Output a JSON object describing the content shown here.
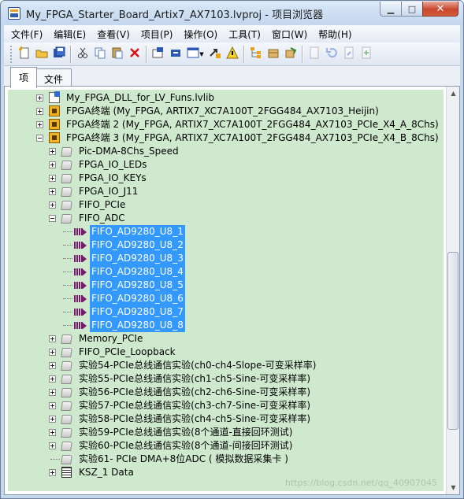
{
  "window": {
    "title": "My_FPGA_Starter_Board_Artix7_AX7103.lvproj - 项目浏览器",
    "caption": {
      "minimize": "▁",
      "maximize": "□",
      "close": "✕"
    }
  },
  "menu": [
    "文件(F)",
    "编辑(E)",
    "查看(V)",
    "项目(P)",
    "操作(O)",
    "工具(T)",
    "窗口(W)",
    "帮助(H)"
  ],
  "toolbar": {
    "buttons": [
      {
        "icon": "new-icon"
      },
      {
        "icon": "open-icon"
      },
      {
        "icon": "save-all-icon"
      },
      {
        "icon": "cut-icon"
      },
      {
        "icon": "copy-icon"
      },
      {
        "icon": "paste-icon"
      },
      {
        "icon": "delete-icon"
      },
      {
        "icon": "build-icon"
      },
      {
        "icon": "deploy-icon"
      },
      {
        "icon": "view-icon"
      },
      {
        "icon": "arrow-icon"
      },
      {
        "icon": "warning-icon"
      },
      {
        "icon": "tree-icon"
      },
      {
        "icon": "package-icon"
      },
      {
        "icon": "link-icon"
      },
      {
        "icon": "doc-icon"
      },
      {
        "icon": "undo-icon"
      },
      {
        "icon": "doc2-icon"
      },
      {
        "icon": "add-icon"
      }
    ]
  },
  "tabs": [
    {
      "label": "项"
    },
    {
      "label": "文件"
    }
  ],
  "tree": [
    {
      "label": "My_FPGA_DLL_for_LV_Funs.lvlib",
      "icon": "lvlib",
      "depth": 0,
      "expander": "plus"
    },
    {
      "label": "FPGA终端 (My_FPGA, ARTIX7_XC7A100T_2FGG484_AX7103_Heijin)",
      "icon": "fpga",
      "depth": 0,
      "expander": "plus"
    },
    {
      "label": "FPGA终端 2 (My_FPGA, ARTIX7_XC7A100T_2FGG484_AX7103_PCIe_X4_A_8Chs)",
      "icon": "fpga",
      "depth": 0,
      "expander": "plus"
    },
    {
      "label": "FPGA终端 3 (My_FPGA, ARTIX7_XC7A100T_2FGG484_AX7103_PCIe_X4_B_8Chs)",
      "icon": "fpga",
      "depth": 0,
      "expander": "minus"
    },
    {
      "label": "Pic-DMA-8Chs_Speed",
      "icon": "folder",
      "depth": 1,
      "expander": "plus"
    },
    {
      "label": "FPGA_IO_LEDs",
      "icon": "folder",
      "depth": 1,
      "expander": "plus"
    },
    {
      "label": "FPGA_IO_KEYs",
      "icon": "folder",
      "depth": 1,
      "expander": "plus"
    },
    {
      "label": "FPGA_IO_J11",
      "icon": "folder",
      "depth": 1,
      "expander": "plus"
    },
    {
      "label": "FIFO_PCIe",
      "icon": "folder",
      "depth": 1,
      "expander": "plus"
    },
    {
      "label": "FIFO_ADC",
      "icon": "folder",
      "depth": 1,
      "expander": "minus"
    },
    {
      "label": "FIFO_AD9280_U8_1",
      "icon": "fifo",
      "depth": 2,
      "selected": true
    },
    {
      "label": "FIFO_AD9280_U8_2",
      "icon": "fifo",
      "depth": 2,
      "selected": true
    },
    {
      "label": "FIFO_AD9280_U8_3",
      "icon": "fifo",
      "depth": 2,
      "selected": true
    },
    {
      "label": "FIFO_AD9280_U8_4",
      "icon": "fifo",
      "depth": 2,
      "selected": true
    },
    {
      "label": "FIFO_AD9280_U8_5",
      "icon": "fifo",
      "depth": 2,
      "selected": true
    },
    {
      "label": "FIFO_AD9280_U8_6",
      "icon": "fifo",
      "depth": 2,
      "selected": true
    },
    {
      "label": "FIFO_AD9280_U8_7",
      "icon": "fifo",
      "depth": 2,
      "selected": true
    },
    {
      "label": "FIFO_AD9280_U8_8",
      "icon": "fifo",
      "depth": 2,
      "selected": true
    },
    {
      "label": "Memory_PCIe",
      "icon": "folder",
      "depth": 1,
      "expander": "plus"
    },
    {
      "label": "FIFO_PCIe_Loopback",
      "icon": "folder",
      "depth": 1,
      "expander": "plus"
    },
    {
      "label": "实验54-PCIe总线通信实验(ch0-ch4-Slope-可变采样率)",
      "icon": "folder",
      "depth": 1,
      "expander": "plus"
    },
    {
      "label": "实验55-PCIe总线通信实验(ch1-ch5-Sine-可变采样率)",
      "icon": "folder",
      "depth": 1,
      "expander": "plus"
    },
    {
      "label": "实验56-PCIe总线通信实验(ch2-ch6-Sine-可变采样率)",
      "icon": "folder",
      "depth": 1,
      "expander": "plus"
    },
    {
      "label": "实验57-PCIe总线通信实验(ch3-ch7-Sine-可变采样率)",
      "icon": "folder",
      "depth": 1,
      "expander": "plus"
    },
    {
      "label": "实验58-PCIe总线通信实验(ch4-ch5-Sine-可变采样率)",
      "icon": "folder",
      "depth": 1,
      "expander": "plus"
    },
    {
      "label": "实验59-PCIe总线通信实验(8个通道-直接回环测试)",
      "icon": "folder",
      "depth": 1,
      "expander": "plus"
    },
    {
      "label": "实验60-PCIe总线通信实验(8个通道-间接回环测试)",
      "icon": "folder",
      "depth": 1,
      "expander": "plus"
    },
    {
      "label": "实验61- PCIe DMA+8位ADC ( 模拟数据采集卡 )",
      "icon": "folder",
      "depth": 1,
      "expander": "none"
    },
    {
      "label": "KSZ_1 Data",
      "icon": "data",
      "depth": 1,
      "expander": "plus"
    }
  ],
  "scrollbar": {
    "up": "▲",
    "down": "▼"
  },
  "watermark": "https://blog.csdn.net/qq_40907045"
}
